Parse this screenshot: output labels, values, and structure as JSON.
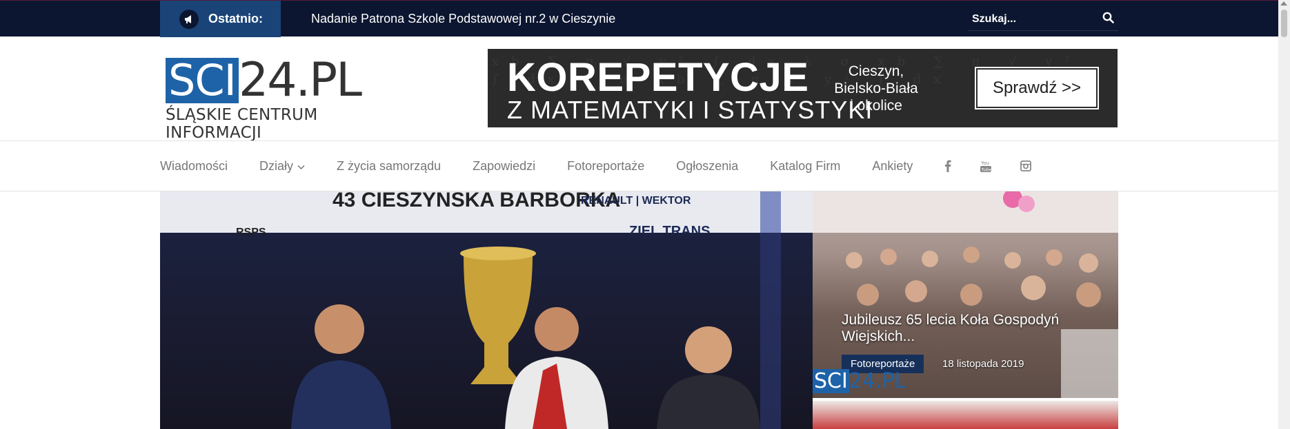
{
  "topbar": {
    "ticker_label": "Ostatnio:",
    "ticker_icon": "megaphone-icon",
    "ticker_text": "Nadanie Patrona Szkole Podstawowej nr.2 w Cieszynie",
    "search_placeholder": "Szukaj...",
    "search_icon": "search-icon"
  },
  "logo": {
    "highlight": "SCI",
    "rest": "24.PL",
    "subtitle": "ŚLĄSKIE CENTRUM INFORMACJI",
    "brand_color": "#1e63a8"
  },
  "banner": {
    "headline": "KOREPETYCJE",
    "subline": "Z MATEMATYKI I STATYSTYKI",
    "locations": [
      "Cieszyn,",
      "Bielsko-Biała",
      "i okolice"
    ],
    "button_label": "Sprawdź >>"
  },
  "nav": {
    "items": [
      {
        "label": "Wiadomości"
      },
      {
        "label": "Działy"
      },
      {
        "label": "Z życia samorządu"
      },
      {
        "label": "Zapowiedzi"
      },
      {
        "label": "Fotoreportaże"
      },
      {
        "label": "Ogłoszenia"
      },
      {
        "label": "Katalog Firm"
      },
      {
        "label": "Ankiety"
      }
    ],
    "social": [
      "facebook-icon",
      "youtube-icon",
      "instagram-icon"
    ]
  },
  "hero": {
    "image_description_icon": "photo-rally-podium"
  },
  "featured": {
    "title": "Jubileusz 65 lecia Koła Gospodyń Wiejskich...",
    "category": "Fotoreportaże",
    "date": "18 listopada 2019",
    "watermark_highlight": "SCI",
    "watermark_rest": "24.PL"
  },
  "colors": {
    "topbar_bg": "#0c1630",
    "ticker_label_bg": "#1a4478",
    "category_badge_bg": "#16305a",
    "nav_text": "#777777"
  }
}
